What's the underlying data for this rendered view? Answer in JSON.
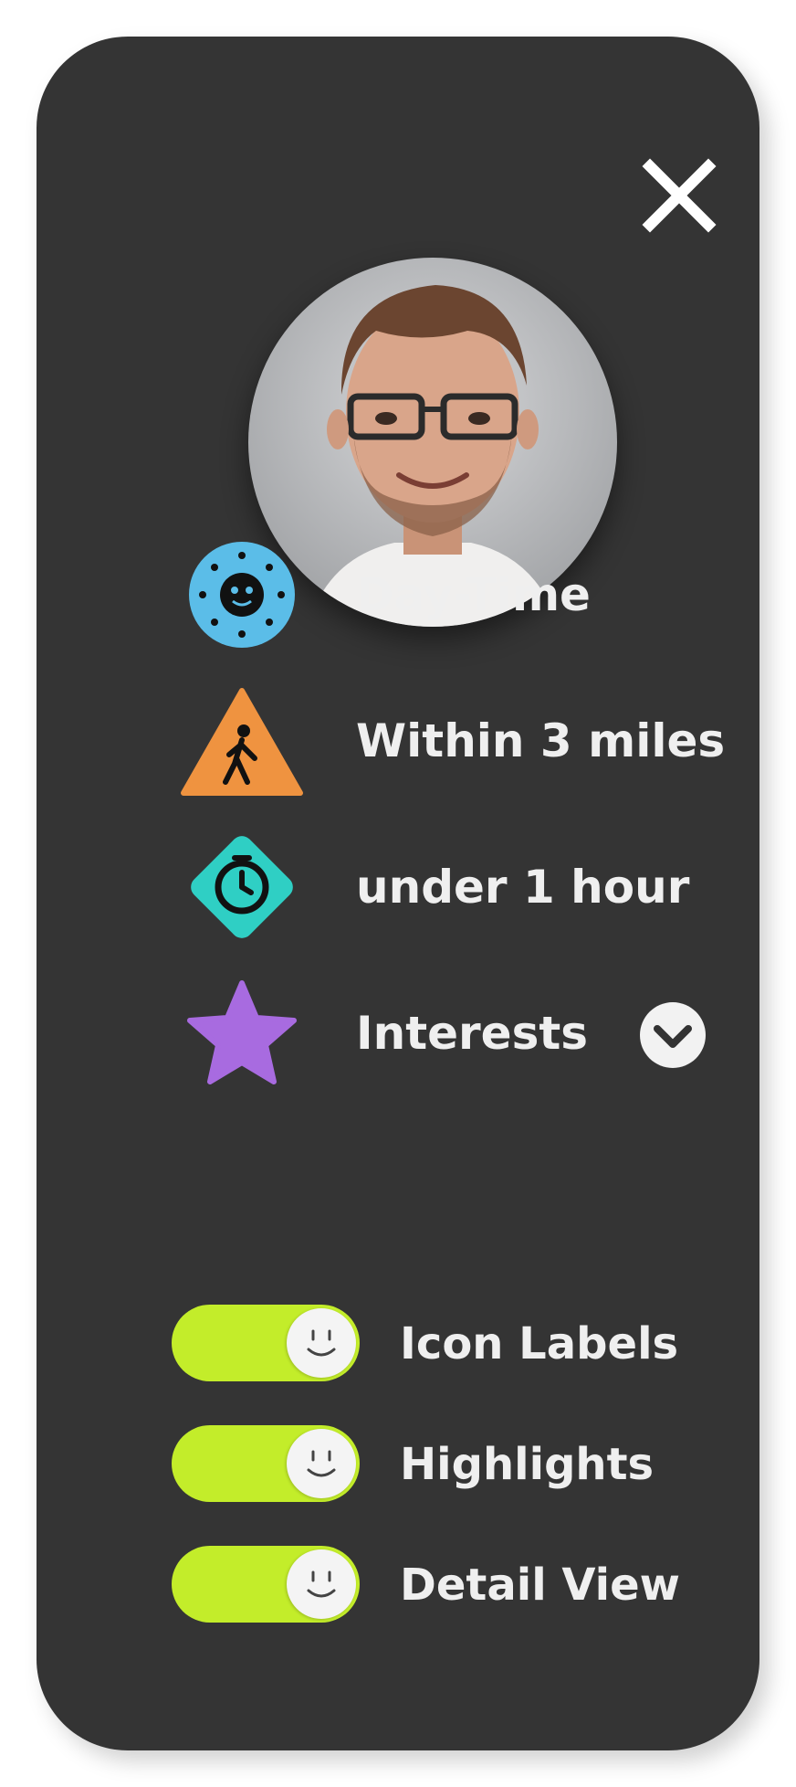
{
  "panel": {
    "close_icon": "close-icon",
    "avatar": "profile-photo"
  },
  "filters": [
    {
      "icon": "sun-icon",
      "label": "Day-Time",
      "color": "#5bbde8"
    },
    {
      "icon": "walking-sign-icon",
      "label": "Within 3 miles",
      "color": "#ef9340"
    },
    {
      "icon": "stopwatch-icon",
      "label": "under 1 hour",
      "color": "#2fcfc4"
    },
    {
      "icon": "star-icon",
      "label": "Interests",
      "color": "#a86be0",
      "dropdown_icon": "chevron-down-icon"
    }
  ],
  "toggles": [
    {
      "label": "Icon Labels",
      "on": true
    },
    {
      "label": "Highlights",
      "on": true
    },
    {
      "label": "Detail View",
      "on": true
    }
  ],
  "colors": {
    "panel_bg": "#343434",
    "toggle_on": "#c3ed2a",
    "text": "#efefef"
  }
}
